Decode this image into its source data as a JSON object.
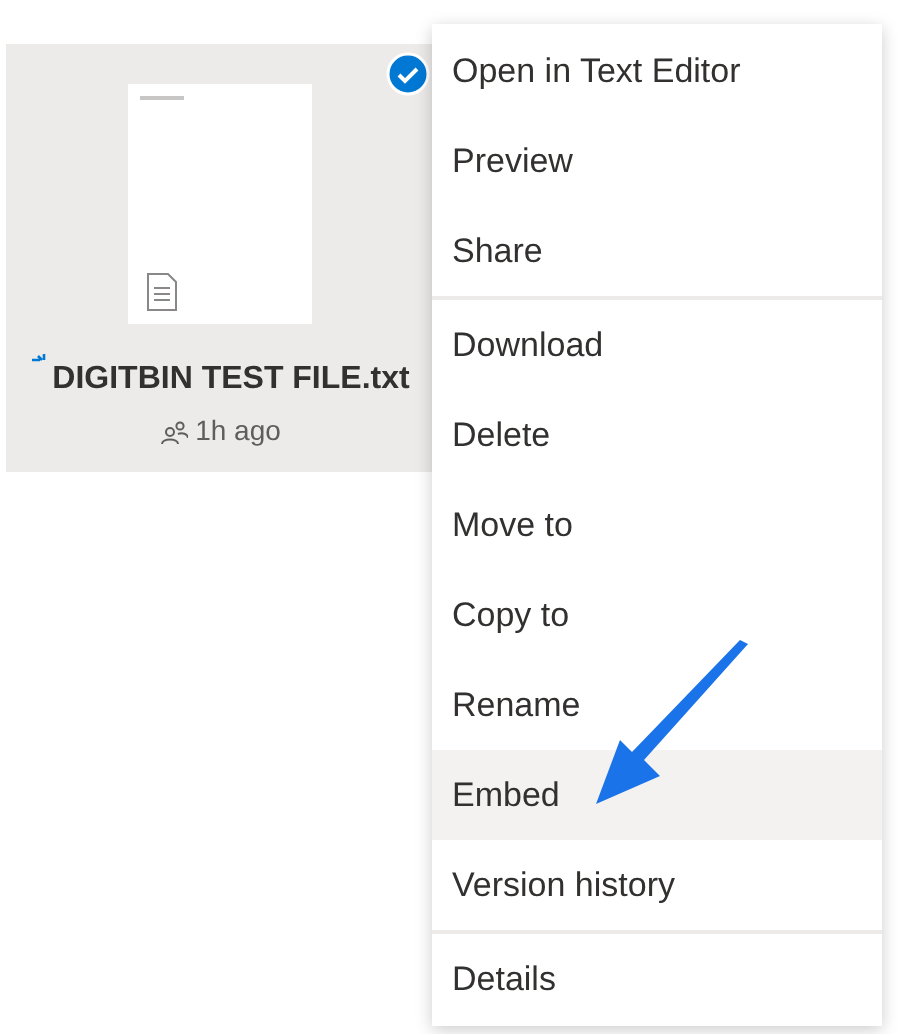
{
  "file_tile": {
    "name": "DIGITBIN TEST FILE.txt",
    "modified": "1h ago",
    "checked": true
  },
  "context_menu": {
    "groups": [
      {
        "items": [
          {
            "label": "Open in Text Editor",
            "selected": false
          },
          {
            "label": "Preview",
            "selected": false
          },
          {
            "label": "Share",
            "selected": false
          }
        ]
      },
      {
        "items": [
          {
            "label": "Download",
            "selected": false
          },
          {
            "label": "Delete",
            "selected": false
          },
          {
            "label": "Move to",
            "selected": false
          },
          {
            "label": "Copy to",
            "selected": false
          },
          {
            "label": "Rename",
            "selected": false
          },
          {
            "label": "Embed",
            "selected": true
          },
          {
            "label": "Version history",
            "selected": false
          }
        ]
      },
      {
        "items": [
          {
            "label": "Details",
            "selected": false
          }
        ]
      }
    ]
  }
}
